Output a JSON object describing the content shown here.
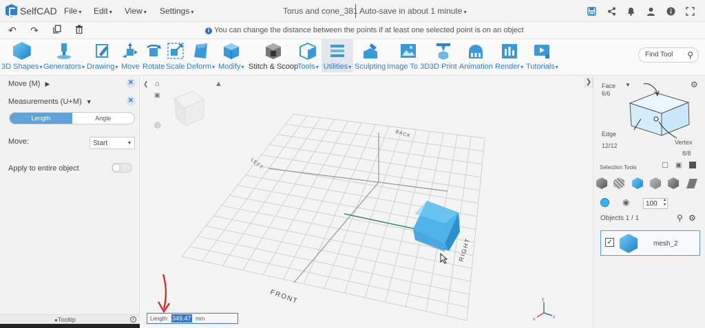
{
  "app": {
    "name": "SelfCAD",
    "brand_color": "#2b7fd4"
  },
  "menubar": {
    "items": [
      "File",
      "Edit",
      "View",
      "Settings"
    ],
    "doc_title": "Torus and cone_381",
    "autosave": "Auto-save in about 1 minute",
    "right_icons": [
      "save-icon",
      "share-icon",
      "bell-icon",
      "user-icon",
      "info-icon",
      "fullscreen-icon"
    ]
  },
  "editbar": {
    "icons": [
      "undo-icon",
      "redo-icon",
      "copy-icon",
      "trash-icon"
    ],
    "hint": "You can change the distance between the points if at least one selected point is on an object"
  },
  "ribbon": {
    "tools": [
      {
        "label": "3D Shapes",
        "dropdown": true
      },
      {
        "label": "Generators",
        "dropdown": true
      },
      {
        "label": "Drawing",
        "dropdown": true
      },
      {
        "label": "Move",
        "dropdown": false
      },
      {
        "label": "Rotate",
        "dropdown": false
      },
      {
        "label": "Scale",
        "dropdown": false
      },
      {
        "label": "Deform",
        "dropdown": true
      },
      {
        "label": "Modify",
        "dropdown": true
      },
      {
        "label": "Stitch & Scoop",
        "dropdown": false
      },
      {
        "label": "Tools",
        "dropdown": true
      },
      {
        "label": "Utilities",
        "dropdown": true
      },
      {
        "label": "Sculpting",
        "dropdown": false
      },
      {
        "label": "Image To 3D",
        "dropdown": false
      },
      {
        "label": "3D Print",
        "dropdown": false
      },
      {
        "label": "Animation",
        "dropdown": false
      },
      {
        "label": "Render",
        "dropdown": true
      },
      {
        "label": "Tutorials",
        "dropdown": true
      }
    ],
    "find_tool": "Find Tool"
  },
  "left_panel": {
    "move_header": "Move (M)",
    "measurements_header": "Measurements (U+M)",
    "segments": [
      "Length",
      "Angle"
    ],
    "active_segment": "Length",
    "move_label": "Move:",
    "move_value": "Start",
    "apply_label": "Apply to entire object",
    "apply_enabled": false,
    "tooltip_label": "Tooltip"
  },
  "viewport": {
    "labels": {
      "back": "BACK",
      "left": "LEFT",
      "front": "FRONT",
      "right": "RIGHT"
    },
    "axis_labels": {
      "x": "x",
      "y": "y",
      "z": "z"
    },
    "length_label": "Length:",
    "length_value": "349.47",
    "length_unit": "mm",
    "object_color": "#4fb3e8"
  },
  "right_panel": {
    "face_label": "Face",
    "face_count": "6/6",
    "edge_label": "Edge",
    "edge_count": "12/12",
    "vertex_label": "Vertex",
    "vertex_count": "8/8",
    "selection_tools_label": "Selection Tools",
    "brush_value": "100",
    "objects_label": "Objects 1 / 1",
    "object_name": "mesh_2",
    "object_checked": true
  }
}
